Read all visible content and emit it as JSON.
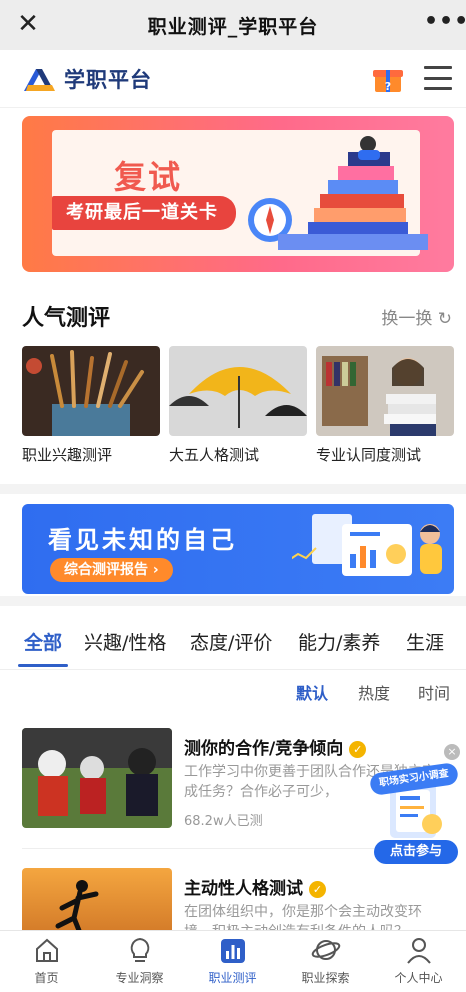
{
  "topbar": {
    "title": "职业测评_学职平台",
    "close_icon": "close-icon",
    "more_icon": "more-icon"
  },
  "header": {
    "logo_text": "学职平台",
    "gift_icon": "gift-box-icon",
    "menu_icon": "hamburger-menu-icon"
  },
  "banner1": {
    "headline": "复试",
    "pill_text": "考研最后一道关卡",
    "colors": {
      "bg_start": "#ff7a45",
      "bg_end": "#ff7b9f",
      "accent": "#e8443e"
    }
  },
  "popular": {
    "title": "人气测评",
    "refresh_label": "换一换",
    "cards": [
      {
        "label": "职业兴趣测评"
      },
      {
        "label": "大五人格测试"
      },
      {
        "label": "专业认同度测试"
      }
    ]
  },
  "banner2": {
    "headline": "看见未知的自己",
    "button": "综合测评报告 ›",
    "colors": {
      "bg": "#2f6df0",
      "button": "#ff8a2b"
    }
  },
  "tabs": [
    "全部",
    "兴趣/性格",
    "态度/评价",
    "能力/素养",
    "生涯"
  ],
  "sort": [
    "默认",
    "热度",
    "时间"
  ],
  "items": [
    {
      "title": "测你的合作/竞争倾向",
      "desc": "工作学习中你更善于团队合作还是独立完成任务？合作必子可少，",
      "count": "68.2w人已测"
    },
    {
      "title": "主动性人格测试",
      "desc": "在团体组织中，你是那个会主动改变环境，积极主动创造有利条件的人吗？",
      "count": ""
    }
  ],
  "float_widget": {
    "ribbon": "职场实习小调查",
    "cta": "点击参与",
    "close": "×"
  },
  "bottom_nav": [
    {
      "label": "首页",
      "icon": "home-icon"
    },
    {
      "label": "专业洞察",
      "icon": "lightbulb-icon"
    },
    {
      "label": "职业测评",
      "icon": "chart-icon",
      "active": true
    },
    {
      "label": "职业探索",
      "icon": "planet-icon"
    },
    {
      "label": "个人中心",
      "icon": "user-icon"
    }
  ],
  "accent_color": "#2f5fc8"
}
